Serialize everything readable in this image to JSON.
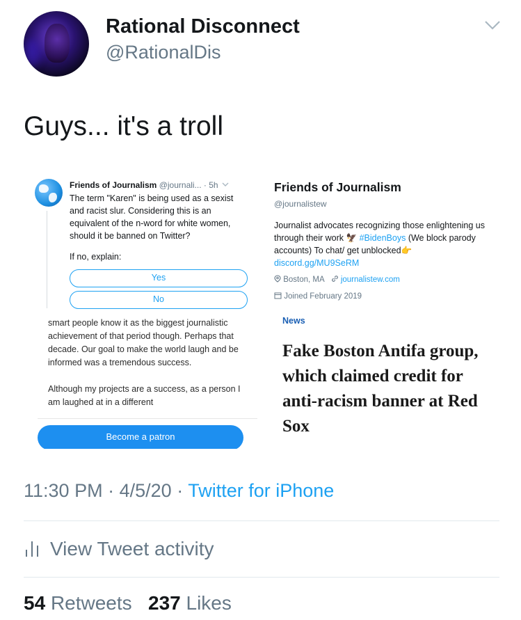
{
  "user": {
    "display_name": "Rational Disconnect",
    "handle": "@RationalDis"
  },
  "tweet": {
    "text": "Guys... it's a troll",
    "time": "11:30 PM",
    "date": "4/5/20",
    "source": "Twitter for iPhone",
    "separator": "·"
  },
  "media": {
    "poll": {
      "account_name": "Friends of Journalism",
      "account_handle": "@journali...",
      "age": "· 5h",
      "body": "The term \"Karen\" is being used as a sexist and racist slur. Considering this is an equivalent of the n-word for white women, should it be banned on Twitter?",
      "explain": "If no, explain:",
      "option_yes": "Yes",
      "option_no": "No"
    },
    "patreon": {
      "paragraph1": "smart people know it as the biggest journalistic achievement of that period though. Perhaps that decade. Our goal to make the world laugh and be informed was a tremendous success.",
      "paragraph2": "Although my projects are a success, as a person I am laughed at in a different",
      "button": "Become a patron"
    },
    "profile": {
      "name": "Friends of Journalism",
      "handle": "@journalistew",
      "bio_1": "Journalist advocates recognizing those enlightening us through their work",
      "hashtag": "#BidenBoys",
      "bio_2": "(We block parody accounts) To chat/ get unblocked",
      "link": "discord.gg/MU9SeRM",
      "location": "Boston, MA",
      "website": "journalistew.com",
      "joined": "Joined February 2019"
    },
    "article": {
      "section": "News",
      "headline": "Fake Boston Antifa group, which claimed credit for anti-racism banner at Red Sox"
    }
  },
  "activity": {
    "label": "View Tweet activity"
  },
  "stats": {
    "retweets_count": "54",
    "retweets_label": "Retweets",
    "likes_count": "237",
    "likes_label": "Likes"
  }
}
